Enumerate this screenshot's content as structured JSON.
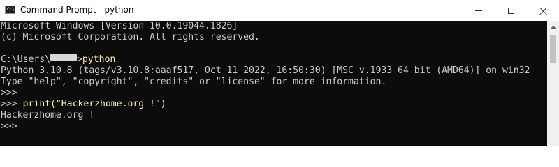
{
  "window": {
    "title": "Command Prompt - python",
    "icon": "cmd-icon",
    "controls": {
      "minimize": "minimize-icon",
      "maximize": "maximize-icon",
      "close": "close-icon"
    }
  },
  "console": {
    "line1": "Microsoft Windows [Version 10.0.19044.1826]",
    "line2": "(c) Microsoft Corporation. All rights reserved.",
    "path_prefix": "C:\\Users\\",
    "path_suffix": ">",
    "command": "python",
    "line4": "Python 3.10.8 (tags/v3.10.8:aaaf517, Oct 11 2022, 16:50:30) [MSC v.1933 64 bit (AMD64)] on win32",
    "line5": "Type \"help\", \"copyright\", \"credits\" or \"license\" for more information.",
    "prompt": ">>> ",
    "prompt_only": ">>>",
    "print_cmd": "print(\"Hackerzhome.org !\")",
    "output": "Hackerzhome.org !"
  },
  "colors": {
    "console_bg": "#0c0c0c",
    "console_text": "#cccccc",
    "input_text": "#f9f1a5",
    "titlebar_bg": "#ffffff"
  }
}
